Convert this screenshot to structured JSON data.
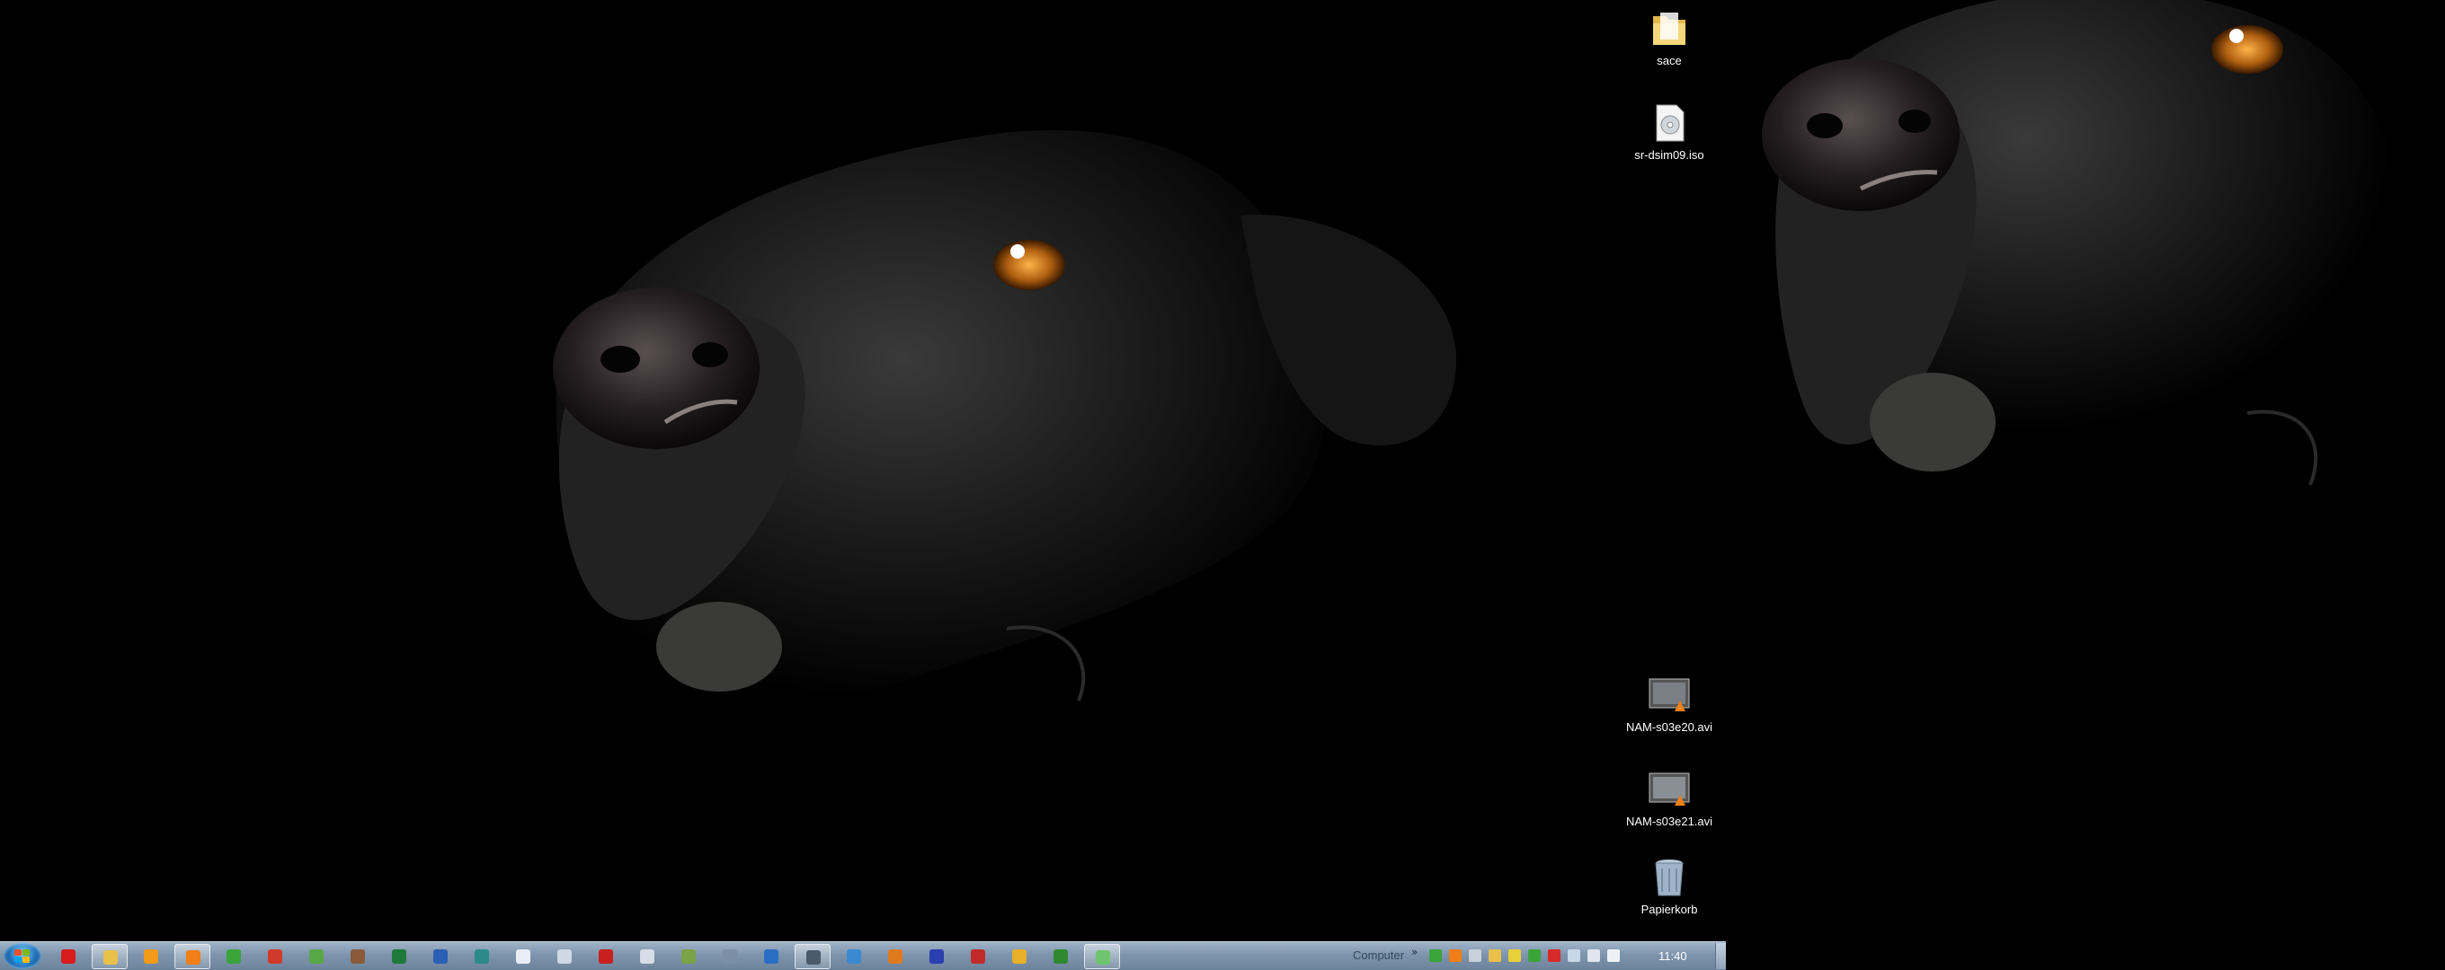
{
  "desktop_left": {
    "icons": [
      {
        "label": "sace",
        "icon": "folder-icon"
      },
      {
        "label": "sr-dsim09.iso",
        "icon": "disc-image-file-icon"
      },
      {
        "label": "NAM-s03e20.avi",
        "icon": "video-file-icon"
      },
      {
        "label": "NAM-s03e21.avi",
        "icon": "video-file-icon"
      },
      {
        "label": "Papierkorb",
        "icon": "recycle-bin-icon"
      }
    ]
  },
  "taskbar": {
    "start_icon": "windows-start-orb-icon",
    "pinned": [
      {
        "icon": "opera-icon",
        "color": "#d81c1c"
      },
      {
        "icon": "windows-explorer-icon",
        "color": "#e8c04a"
      },
      {
        "icon": "media-player-icon",
        "color": "#f29a1a"
      },
      {
        "icon": "vlc-icon",
        "color": "#f07f17"
      },
      {
        "icon": "green-app-icon",
        "color": "#3aa43a"
      },
      {
        "icon": "red-app-icon",
        "color": "#d13a2a"
      },
      {
        "icon": "image-viewer-icon",
        "color": "#58a846"
      },
      {
        "icon": "tool-icon",
        "color": "#8a5a3a"
      },
      {
        "icon": "excel-icon",
        "color": "#1f7a3a"
      },
      {
        "icon": "word-icon",
        "color": "#2b5fb3"
      },
      {
        "icon": "publisher-icon",
        "color": "#2d8a8a"
      },
      {
        "icon": "document-icon",
        "color": "#e8eef6"
      },
      {
        "icon": "copy-icon",
        "color": "#cfd8e4"
      },
      {
        "icon": "pdf-reader-icon",
        "color": "#c8201d"
      },
      {
        "icon": "disc-icon",
        "color": "#d6dde6"
      },
      {
        "icon": "editor-icon",
        "color": "#7aa246"
      },
      {
        "icon": "search-app-icon",
        "color": "#7a8fa6"
      },
      {
        "icon": "calculator-icon",
        "color": "#2a6fc4"
      },
      {
        "icon": "network-icon",
        "color": "#4a5a6a"
      },
      {
        "icon": "remote-desktop-icon",
        "color": "#3a8ad0"
      },
      {
        "icon": "firefox-icon",
        "color": "#e07a1f"
      },
      {
        "icon": "blue-app-icon",
        "color": "#2a3fb0"
      },
      {
        "icon": "red-box-icon",
        "color": "#c22a2a"
      },
      {
        "icon": "yellow-app-icon",
        "color": "#e8b02a"
      },
      {
        "icon": "green-ball-icon",
        "color": "#2f8a2f"
      },
      {
        "icon": "notepad-icon",
        "color": "#6fc46f"
      }
    ],
    "toolbar_label": "Computer",
    "toolbar_more": "»",
    "tray_icons": [
      {
        "icon": "green-tray-icon",
        "color": "#3aa43a"
      },
      {
        "icon": "vlc-tray-icon",
        "color": "#f07f17"
      },
      {
        "icon": "usb-tray-icon",
        "color": "#c8d0da"
      },
      {
        "icon": "folder-tray-icon",
        "color": "#e8c04a"
      },
      {
        "icon": "shield-tray-icon",
        "color": "#e8d03a"
      },
      {
        "icon": "check-tray-icon",
        "color": "#3aa43a"
      },
      {
        "icon": "red-tray-icon",
        "color": "#d82a2a"
      },
      {
        "icon": "flag-tray-icon",
        "color": "#c8d8e8"
      },
      {
        "icon": "network-tray-icon",
        "color": "#dfe6ee"
      },
      {
        "icon": "speaker-tray-icon",
        "color": "#eef2f6"
      }
    ],
    "clock": "11:40"
  }
}
